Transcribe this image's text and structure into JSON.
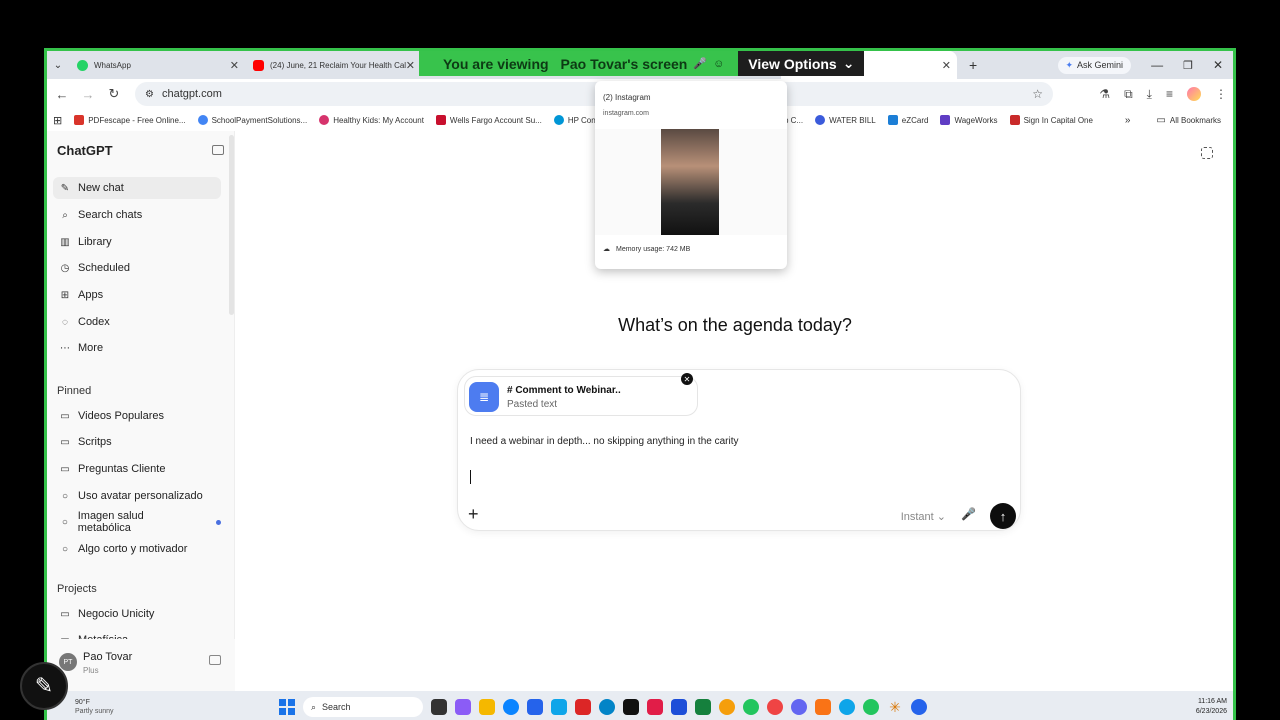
{
  "share": {
    "viewing_prefix": "You are viewing",
    "presenter": "Pao Tovar's screen",
    "view_options": "View Options"
  },
  "tabs": [
    {
      "title": "WhatsApp",
      "color": "#25d366"
    },
    {
      "title": "(24) June, 21 Reclaim Your Health Cal",
      "color": "#ff0000"
    },
    {
      "title": "",
      "color": "#ffffff"
    }
  ],
  "tabstrip": {
    "ask_gemini": "Ask Gemini"
  },
  "address": {
    "url": "chatgpt.com"
  },
  "bookmarks": [
    {
      "label": "PDFescape - Free Online...",
      "color": "#d9342b"
    },
    {
      "label": "SchoolPaymentSolutions...",
      "color": "#4285f4"
    },
    {
      "label": "Healthy Kids: My Account",
      "color": "#d6336c"
    },
    {
      "label": "Wells Fargo Account Su...",
      "color": "#c8102e"
    },
    {
      "label": "HP Connect",
      "color": "#0096d6"
    },
    {
      "label": "...op C...",
      "color": "#888888"
    },
    {
      "label": "WATER BILL",
      "color": "#3b5bdb"
    },
    {
      "label": "eZCard",
      "color": "#1c7ed6"
    },
    {
      "label": "WageWorks",
      "color": "#5f3dc4"
    },
    {
      "label": "Sign In Capital One",
      "color": "#c92a2a"
    }
  ],
  "bookmarks_all": "All Bookmarks",
  "hovercard": {
    "title": "(2) Instagram",
    "url": "instagram.com",
    "memory": "Memory usage: 742 MB"
  },
  "sidebar": {
    "brand": "ChatGPT",
    "items": [
      {
        "label": "New chat",
        "icon": "✎"
      },
      {
        "label": "Search chats",
        "icon": "⌕"
      },
      {
        "label": "Library",
        "icon": "▥"
      },
      {
        "label": "Scheduled",
        "icon": "◷"
      },
      {
        "label": "Apps",
        "icon": "⊞"
      },
      {
        "label": "Codex",
        "icon": "◌"
      },
      {
        "label": "More",
        "icon": "⋯"
      }
    ],
    "pinned_heading": "Pinned",
    "pinned": [
      {
        "label": "Videos Populares"
      },
      {
        "label": "Scritps"
      },
      {
        "label": "Preguntas Cliente"
      },
      {
        "label": "Uso avatar personalizado"
      },
      {
        "label": "Imagen salud metabólica"
      },
      {
        "label": "Algo corto y motivador"
      }
    ],
    "projects_heading": "Projects",
    "projects": [
      {
        "label": "Negocio Unicity"
      },
      {
        "label": "Metafísica"
      }
    ],
    "user": {
      "initials": "PT",
      "name": "Pao Tovar",
      "plan": "Plus"
    }
  },
  "main": {
    "heading": "What’s on the agenda today?",
    "attachment": {
      "name": "# Comment to Webinar..",
      "type": "Pasted text"
    },
    "prompt": "I need a webinar in depth... no skipping anything in the carity",
    "mode": "Instant"
  },
  "taskbar": {
    "temp": "90°F",
    "condition": "Partly sunny",
    "search": "Search",
    "time": "11:16 AM",
    "date": "6/23/2026"
  }
}
